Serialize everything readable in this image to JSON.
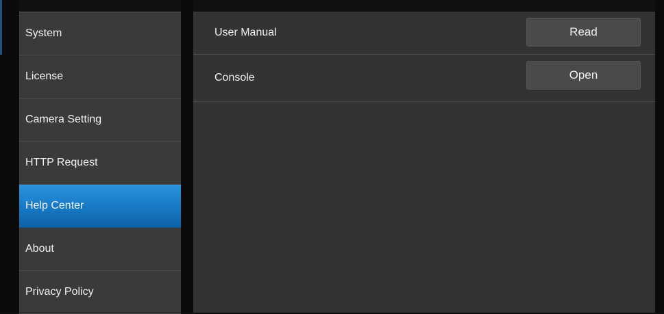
{
  "sidebar": {
    "items": [
      {
        "label": "System"
      },
      {
        "label": "License"
      },
      {
        "label": "Camera Setting"
      },
      {
        "label": "HTTP Request"
      },
      {
        "label": "Help Center",
        "active": true
      },
      {
        "label": "About"
      },
      {
        "label": "Privacy Policy"
      }
    ]
  },
  "main": {
    "rows": [
      {
        "label": "User Manual",
        "button": "Read"
      },
      {
        "label": "Console",
        "button": "Open"
      }
    ]
  },
  "colors": {
    "active": "#1778c4",
    "panel": "#333333",
    "sidebar": "#3a3a3a",
    "background": "#101010"
  }
}
